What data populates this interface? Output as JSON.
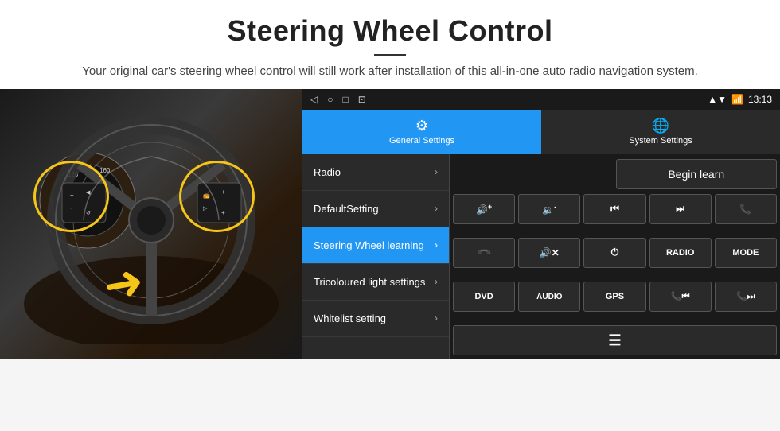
{
  "header": {
    "title": "Steering Wheel Control",
    "subtitle": "Your original car's steering wheel control will still work after installation of this all-in-one auto radio navigation system."
  },
  "status_bar": {
    "time": "13:13",
    "nav_icons": [
      "◁",
      "○",
      "□",
      "⊡"
    ]
  },
  "tabs": [
    {
      "id": "general",
      "label": "General Settings",
      "icon": "⚙",
      "active": true
    },
    {
      "id": "system",
      "label": "System Settings",
      "icon": "🌐",
      "active": false
    }
  ],
  "menu_items": [
    {
      "id": "radio",
      "label": "Radio",
      "active": false
    },
    {
      "id": "default",
      "label": "DefaultSetting",
      "active": false
    },
    {
      "id": "steering",
      "label": "Steering Wheel learning",
      "active": true
    },
    {
      "id": "tricoloured",
      "label": "Tricoloured light settings",
      "active": false
    },
    {
      "id": "whitelist",
      "label": "Whitelist setting",
      "active": false
    }
  ],
  "controls": {
    "begin_learn_label": "Begin learn",
    "buttons_row1": [
      {
        "id": "vol-up",
        "icon": "🔊+",
        "text": "🔊+"
      },
      {
        "id": "vol-down",
        "icon": "🔉-",
        "text": "🔉-"
      },
      {
        "id": "prev-track",
        "icon": "⏮",
        "text": "⏮"
      },
      {
        "id": "next-track",
        "icon": "⏭",
        "text": "⏭"
      },
      {
        "id": "phone",
        "icon": "📞",
        "text": "📞"
      }
    ],
    "buttons_row2": [
      {
        "id": "hang-up",
        "icon": "📵",
        "text": "↩"
      },
      {
        "id": "mute",
        "icon": "🔇",
        "text": "🔊✕"
      },
      {
        "id": "power",
        "icon": "⏻",
        "text": "⏻"
      },
      {
        "id": "radio-btn",
        "text": "RADIO"
      },
      {
        "id": "mode-btn",
        "text": "MODE"
      }
    ],
    "buttons_row3": [
      {
        "id": "dvd",
        "text": "DVD"
      },
      {
        "id": "audio",
        "text": "AUDIO"
      },
      {
        "id": "gps",
        "text": "GPS"
      },
      {
        "id": "tel-prev",
        "text": "📞⏮"
      },
      {
        "id": "tel-next",
        "text": "📞⏭"
      }
    ],
    "buttons_row4": [
      {
        "id": "list",
        "text": "☰"
      }
    ]
  }
}
